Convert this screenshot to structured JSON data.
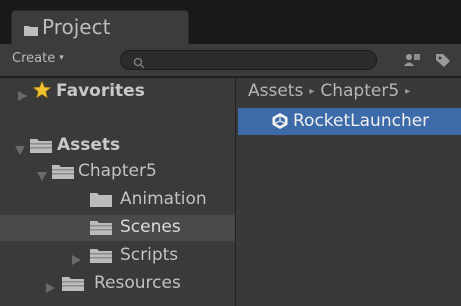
{
  "tab": {
    "title": "Project",
    "icon": "folder-icon"
  },
  "toolbar": {
    "create_label": "Create",
    "create_arrow": "▾",
    "search_icon": "search-icon",
    "filter_type_icon": "filter-by-type-icon",
    "filter_label_icon": "filter-by-label-icon"
  },
  "tree": {
    "favorites": {
      "label": "Favorites",
      "icon": "star-icon"
    },
    "assets": {
      "label": "Assets",
      "icon": "folder-icon"
    },
    "chapter5": {
      "label": "Chapter5",
      "icon": "folder-icon"
    },
    "animation": {
      "label": "Animation",
      "icon": "folder-icon"
    },
    "scenes": {
      "label": "Scenes",
      "icon": "folder-icon",
      "selected": true
    },
    "scripts": {
      "label": "Scripts",
      "icon": "folder-icon"
    },
    "resources": {
      "label": "Resources",
      "icon": "folder-icon"
    }
  },
  "breadcrumb": {
    "item1": "Assets",
    "item2": "Chapter5",
    "separator": "▸"
  },
  "assets_list": [
    {
      "name": "RocketLauncher",
      "icon": "unity-scene-icon",
      "selected": true
    }
  ],
  "colors": {
    "panel_bg": "#3a3a3a",
    "selection_blue": "#3d6aa8",
    "selected_row_gray": "#4a4a4a",
    "star_yellow": "#f2c230"
  }
}
